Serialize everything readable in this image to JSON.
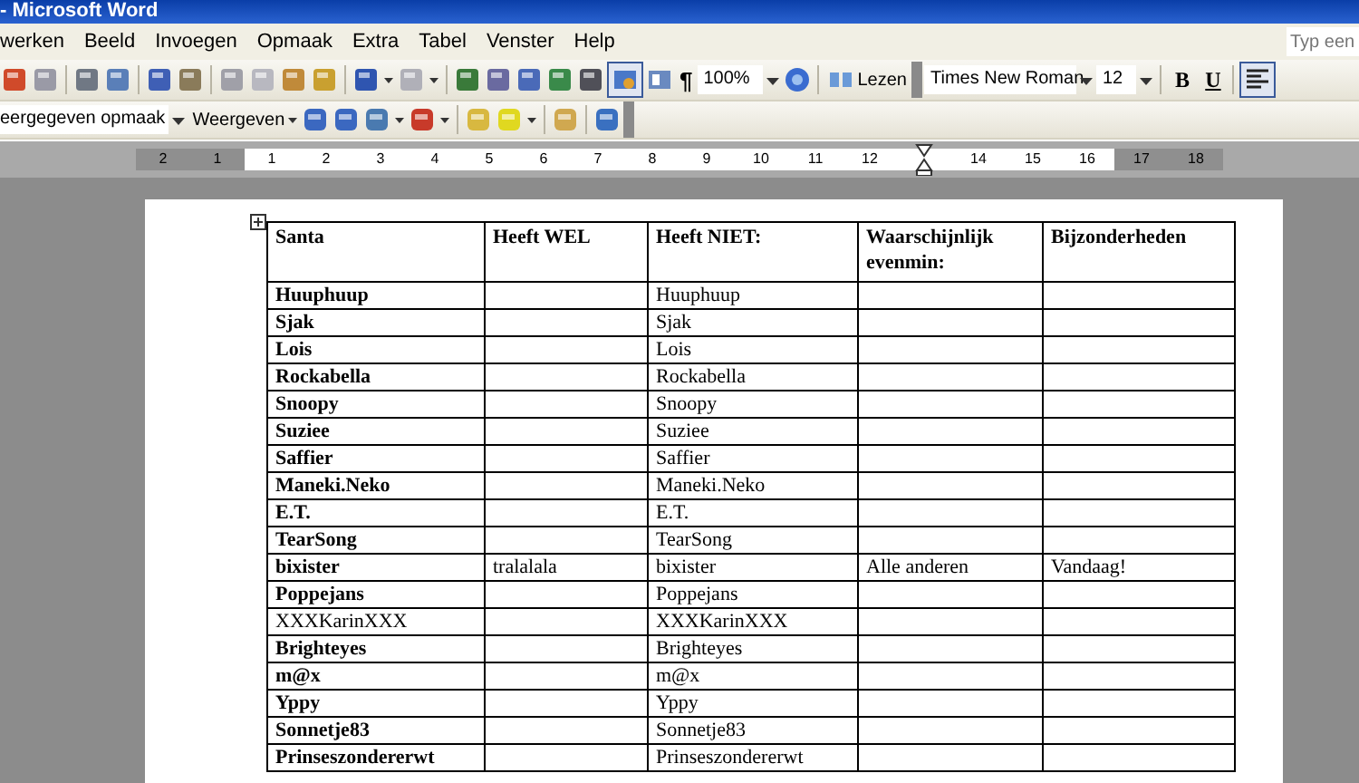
{
  "window": {
    "title": "- Microsoft Word"
  },
  "menu": [
    "werken",
    "Beeld",
    "Invoegen",
    "Opmaak",
    "Extra",
    "Tabel",
    "Venster",
    "Help"
  ],
  "help_search": {
    "placeholder": "Typ een"
  },
  "toolbar": {
    "zoom": "100%",
    "reading_button": "Lezen",
    "font": "Times New Roman",
    "size": "12",
    "bold": "B",
    "underline": "U",
    "pilcrow": "¶",
    "toggle_pressed": true,
    "align_left_pressed": true
  },
  "review_toolbar": {
    "display_combo": "eergegeven opmaak",
    "display_menu": "Weergeven"
  },
  "ruler": [
    {
      "label": "2",
      "margin": true
    },
    {
      "label": "1",
      "margin": true
    },
    {
      "label": "1",
      "margin": false
    },
    {
      "label": "2",
      "margin": false
    },
    {
      "label": "3",
      "margin": false
    },
    {
      "label": "4",
      "margin": false
    },
    {
      "label": "5",
      "margin": false
    },
    {
      "label": "6",
      "margin": false
    },
    {
      "label": "7",
      "margin": false
    },
    {
      "label": "8",
      "margin": false
    },
    {
      "label": "9",
      "margin": false
    },
    {
      "label": "10",
      "margin": false
    },
    {
      "label": "11",
      "margin": false
    },
    {
      "label": "12",
      "margin": false
    },
    {
      "kind": "indent",
      "margin": false
    },
    {
      "label": "14",
      "margin": false
    },
    {
      "label": "15",
      "margin": false
    },
    {
      "label": "16",
      "margin": false
    },
    {
      "label": "17",
      "margin": true
    },
    {
      "label": "18",
      "margin": true
    }
  ],
  "table": {
    "columns": [
      "Santa",
      "Heeft WEL",
      "Heeft NIET:",
      "Waarschijnlijk evenmin:",
      "Bijzonderheden"
    ],
    "rows": [
      {
        "santa": "Huuphuup",
        "heeft_niet": "Huuphuup",
        "bold": true
      },
      {
        "santa": "Sjak",
        "heeft_niet": "Sjak",
        "bold": true
      },
      {
        "santa": "Lois",
        "heeft_niet": "Lois",
        "bold": true
      },
      {
        "santa": "Rockabella",
        "heeft_niet": "Rockabella",
        "bold": true
      },
      {
        "santa": "Snoopy",
        "heeft_niet": "Snoopy",
        "bold": true
      },
      {
        "santa": "Suziee",
        "heeft_niet": "Suziee",
        "bold": true
      },
      {
        "santa": "Saffier",
        "heeft_niet": "Saffier",
        "bold": true
      },
      {
        "santa": "Maneki.Neko",
        "heeft_niet": "Maneki.Neko",
        "bold": true
      },
      {
        "santa": "E.T.",
        "heeft_niet": "E.T.",
        "bold": true
      },
      {
        "santa": "TearSong",
        "heeft_niet": "TearSong",
        "bold": true
      },
      {
        "santa": "bixister",
        "heeft_wel": "tralalala",
        "heeft_niet": "bixister",
        "waarschijnlijk_evenmin": "Alle anderen",
        "bijzonderheden": "Vandaag!",
        "bold": true
      },
      {
        "santa": "Poppejans",
        "heeft_niet": "Poppejans",
        "bold": true
      },
      {
        "santa": "XXXKarinXXX",
        "heeft_niet": "XXXKarinXXX",
        "bold": false
      },
      {
        "santa": "Brighteyes",
        "heeft_niet": "Brighteyes",
        "bold": true
      },
      {
        "santa": "m@x",
        "heeft_niet": "m@x",
        "bold": true
      },
      {
        "santa": "Yppy",
        "heeft_niet": "Yppy",
        "bold": true
      },
      {
        "santa": "Sonnetje83",
        "heeft_niet": "Sonnetje83",
        "bold": true
      },
      {
        "santa": "Prinseszondererwt",
        "heeft_niet": "Prinseszondererwt",
        "bold": true
      }
    ]
  }
}
